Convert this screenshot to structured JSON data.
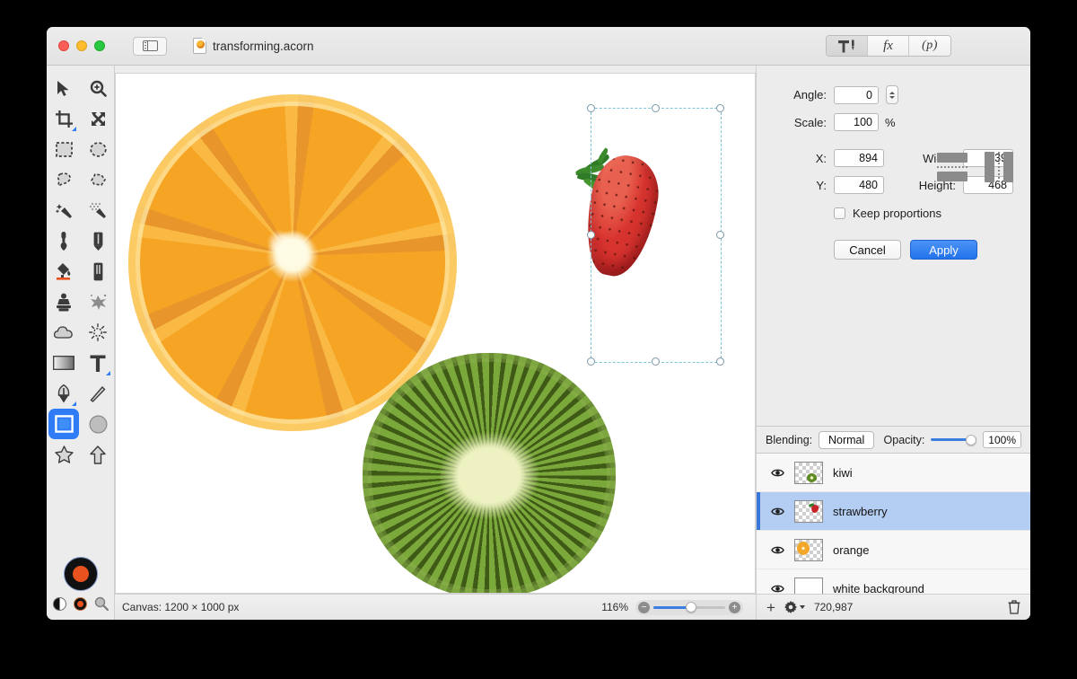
{
  "window": {
    "title": "transforming.acorn",
    "traffic_lights": [
      "close",
      "minimize",
      "zoom"
    ],
    "sidebar_toggle_icon": "sidebar-toggle-icon",
    "document_icon": "acorn-document-icon"
  },
  "inspector_tabs": [
    {
      "id": "tools",
      "icon": "hammer-tool-icon",
      "label": "",
      "active": true
    },
    {
      "id": "filters",
      "icon": "fx-icon",
      "label": "fx",
      "active": false
    },
    {
      "id": "presets",
      "icon": "palette-icon",
      "label": "(p)",
      "active": false
    }
  ],
  "toolbar": {
    "tools": [
      {
        "name": "move-tool",
        "icon": "arrow-pointer-icon",
        "selected": false
      },
      {
        "name": "zoom-tool",
        "icon": "magnifier-plus-icon",
        "selected": false
      },
      {
        "name": "crop-tool",
        "icon": "crop-icon",
        "selected": false,
        "has_submenu": true
      },
      {
        "name": "transform-tool",
        "icon": "move-arrows-icon",
        "selected": false
      },
      {
        "name": "rectangular-select-tool",
        "icon": "dashed-rectangle-icon",
        "selected": false
      },
      {
        "name": "elliptical-select-tool",
        "icon": "dashed-ellipse-icon",
        "selected": false
      },
      {
        "name": "lasso-select-tool",
        "icon": "lasso-icon",
        "selected": false
      },
      {
        "name": "polygon-select-tool",
        "icon": "polygon-lasso-icon",
        "selected": false
      },
      {
        "name": "magic-wand-tool",
        "icon": "magic-wand-icon",
        "selected": false
      },
      {
        "name": "instant-alpha-tool",
        "icon": "magic-wand-dots-icon",
        "selected": false
      },
      {
        "name": "brush-tool",
        "icon": "brush-icon",
        "selected": false
      },
      {
        "name": "pencil-tool",
        "icon": "pencil-icon",
        "selected": false
      },
      {
        "name": "paint-bucket-tool",
        "icon": "paint-bucket-icon",
        "selected": false
      },
      {
        "name": "eraser-tool",
        "icon": "eraser-icon",
        "selected": false
      },
      {
        "name": "clone-stamp-tool",
        "icon": "clone-stamp-icon",
        "selected": false
      },
      {
        "name": "smudge-tool",
        "icon": "smudge-splat-icon",
        "selected": false
      },
      {
        "name": "blur-tool",
        "icon": "cloud-blur-icon",
        "selected": false
      },
      {
        "name": "dodge-burn-tool",
        "icon": "sun-icon",
        "selected": false
      },
      {
        "name": "gradient-tool",
        "icon": "gradient-icon",
        "selected": false
      },
      {
        "name": "text-tool",
        "icon": "text-t-icon",
        "selected": false,
        "has_submenu": true
      },
      {
        "name": "bezier-pen-tool",
        "icon": "pen-nib-icon",
        "selected": false,
        "has_submenu": true
      },
      {
        "name": "line-tool",
        "icon": "line-icon",
        "selected": false
      },
      {
        "name": "rectangle-shape-tool",
        "icon": "rectangle-icon",
        "selected": true
      },
      {
        "name": "ellipse-shape-tool",
        "icon": "filled-circle-icon",
        "selected": false
      },
      {
        "name": "star-shape-tool",
        "icon": "star-icon",
        "selected": false
      },
      {
        "name": "arrow-shape-tool",
        "icon": "arrow-up-icon",
        "selected": false
      }
    ],
    "color_swatch": {
      "name": "foreground-color-swatch",
      "stroke_color": "#111111",
      "fill_color": "#e8521f"
    },
    "swatch_extras": [
      {
        "name": "black-white-swatch-icon"
      },
      {
        "name": "fill-color-swatch-icon"
      },
      {
        "name": "color-picker-magnifier-icon"
      }
    ]
  },
  "transform": {
    "angle_label": "Angle:",
    "angle_value": "0",
    "scale_label": "Scale:",
    "scale_value": "100",
    "scale_unit": "%",
    "x_label": "X:",
    "x_value": "894",
    "y_label": "Y:",
    "y_value": "480",
    "width_label": "Width:",
    "width_value": "239",
    "height_label": "Height:",
    "height_value": "468",
    "keep_proportions_label": "Keep proportions",
    "keep_proportions_checked": false,
    "cancel_label": "Cancel",
    "apply_label": "Apply",
    "flip_horizontal_icon": "flip-horizontal-icon",
    "flip_vertical_icon": "flip-vertical-icon",
    "accent_color": "#2273ec"
  },
  "layers_panel": {
    "blending_label": "Blending:",
    "blending_value": "Normal",
    "opacity_label": "Opacity:",
    "opacity_value": "100%",
    "layers": [
      {
        "name": "kiwi",
        "visible": true,
        "selected": false,
        "thumb": "kiwi-thumbnail"
      },
      {
        "name": "strawberry",
        "visible": true,
        "selected": true,
        "thumb": "strawberry-thumbnail"
      },
      {
        "name": "orange",
        "visible": true,
        "selected": false,
        "thumb": "orange-thumbnail"
      },
      {
        "name": "white background",
        "visible": true,
        "selected": false,
        "thumb": "white-thumbnail"
      }
    ],
    "footer": {
      "add_icon": "plus-icon",
      "settings_icon": "gear-icon",
      "memory_text": "720,987",
      "delete_icon": "trash-icon"
    },
    "selection_color": "#b4cdf2"
  },
  "status_bar": {
    "canvas_label": "Canvas: 1200 × 1000 px",
    "zoom_value": "116%",
    "zoom_out_icon": "zoom-out-icon",
    "zoom_in_icon": "zoom-in-icon"
  },
  "canvas": {
    "selection_handles": 8,
    "selected_object": "strawberry",
    "objects": [
      {
        "name": "orange-slice"
      },
      {
        "name": "kiwi-slice"
      },
      {
        "name": "strawberry"
      }
    ]
  }
}
